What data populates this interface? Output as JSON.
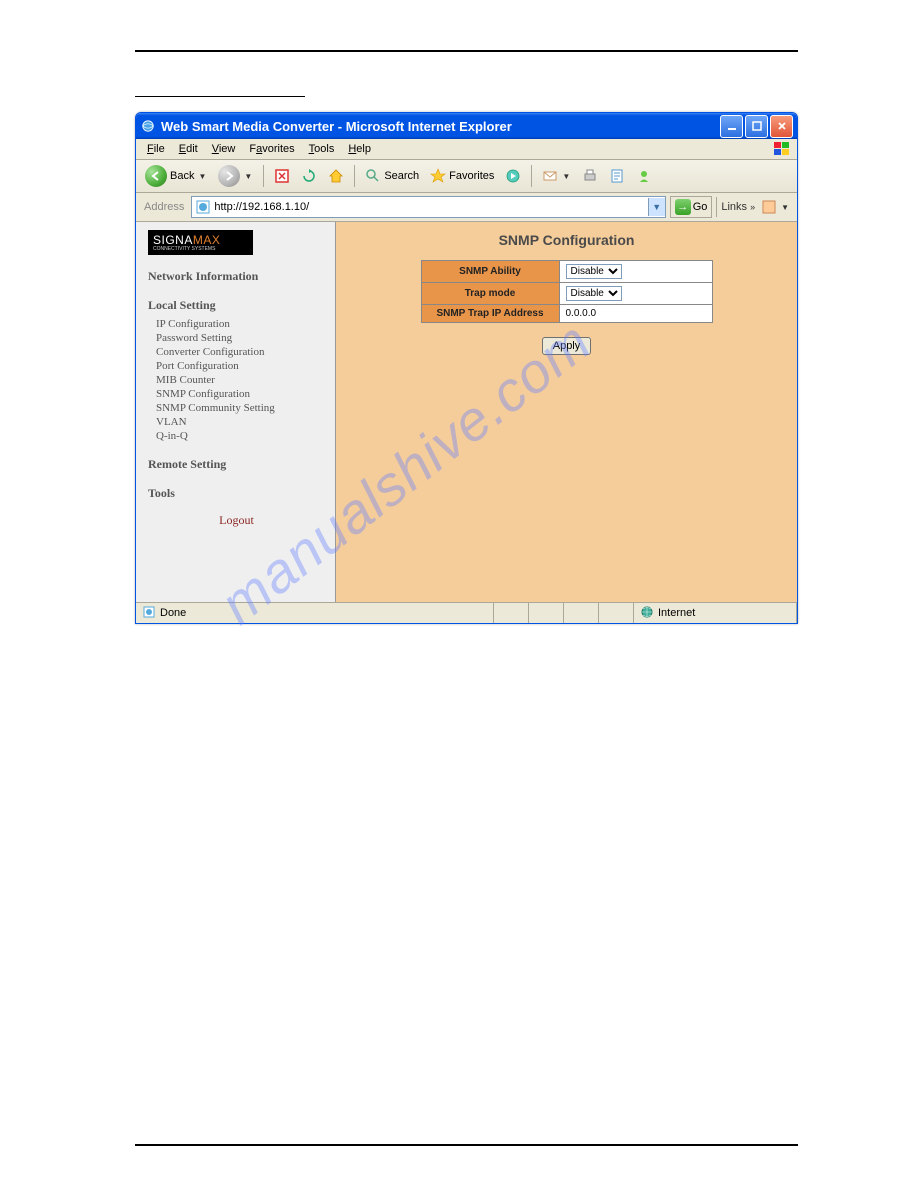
{
  "watermark": "manualshive.com",
  "window": {
    "title": "Web Smart Media Converter - Microsoft Internet Explorer"
  },
  "menubar": {
    "file": "File",
    "edit": "Edit",
    "view": "View",
    "favorites": "Favorites",
    "tools": "Tools",
    "help": "Help"
  },
  "toolbar": {
    "back": "Back",
    "search": "Search",
    "favorites": "Favorites"
  },
  "addressbar": {
    "label": "Address",
    "url": "http://192.168.1.10/",
    "go": "Go",
    "links": "Links"
  },
  "sidebar": {
    "logo_main": "SIGNA",
    "logo_accent": "MAX",
    "logo_sub": "CONNECTIVITY SYSTEMS",
    "network_information": "Network Information",
    "local_setting": "Local Setting",
    "items": [
      "IP Configuration",
      "Password Setting",
      "Converter Configuration",
      "Port Configuration",
      "MIB Counter",
      "SNMP Configuration",
      "SNMP Community Setting",
      "VLAN",
      "Q-in-Q"
    ],
    "remote_setting": "Remote Setting",
    "tools": "Tools",
    "logout": "Logout"
  },
  "main": {
    "heading": "SNMP Configuration",
    "rows": {
      "snmp_ability_label": "SNMP Ability",
      "snmp_ability_value": "Disable",
      "trap_mode_label": "Trap mode",
      "trap_mode_value": "Disable",
      "trap_ip_label": "SNMP Trap IP Address",
      "trap_ip_value": "0.0.0.0"
    },
    "apply": "Apply"
  },
  "statusbar": {
    "done": "Done",
    "zone": "Internet"
  }
}
